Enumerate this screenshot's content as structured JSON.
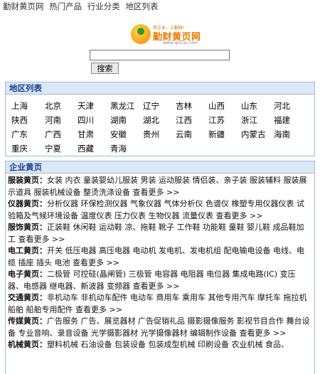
{
  "topnav": [
    "勤财黄页网",
    "热门产品",
    "行业分类",
    "地区列表"
  ],
  "logo": {
    "slogan": "我企业，上勤财!",
    "text": "勤财黄页网",
    "url": "www.qincai.com"
  },
  "search": {
    "button_label": "搜索",
    "value": ""
  },
  "region": {
    "title": "地区列表",
    "rows": [
      [
        "上海",
        "北京",
        "天津",
        "黑龙江",
        "辽宁",
        "吉林",
        "山西",
        "山东",
        "河北"
      ],
      [
        "陕西",
        "河南",
        "四川",
        "湖南",
        "湖北",
        "江西",
        "江苏",
        "浙江",
        "福建"
      ],
      [
        "广东",
        "广西",
        "甘肃",
        "安徽",
        "贵州",
        "云南",
        "新疆",
        "内蒙古",
        "海南"
      ],
      [
        "重庆",
        "宁夏",
        "西藏",
        "青海"
      ]
    ]
  },
  "business": {
    "title": "企业黄页",
    "items": [
      {
        "cat": "服装黄页：",
        "items": "女装 内衣 童装婴幼儿服装 男装 运动服装 情侣装、亲子装 服装辅料 服装展示道具 服装机械设备 整烫洗涤设备",
        "more": "查看更多",
        "arrow": ">>"
      },
      {
        "cat": "仪器黄页：",
        "items": "分析仪器 环保检测仪器 气象仪器 气体分析仪 色谱仪 橡塑专用仪器仪表 试验箱及气候环境设备 温度仪表 压力仪表 生物仪器 流量仪表",
        "more": "查看更多",
        "arrow": ">>"
      },
      {
        "cat": "服饰黄页：",
        "items": "正装鞋 休闲鞋 运动鞋 凉、拖鞋 靴子 工作鞋 功能鞋 童鞋 婴儿鞋 成品鞋加工",
        "more": "查看更多",
        "arrow": ">>"
      },
      {
        "cat": "电工黄页：",
        "items": "开关 低压电器 高压电器 电动机 发电机、发电机组 配电输电设备 电线、电缆 插座 插头 电池",
        "more": "查看更多",
        "arrow": ">>"
      },
      {
        "cat": "电子黄页：",
        "items": "二极管 可控硅(晶闸管) 三极管 电容器 电阻器 电位器 集成电路(IC) 变压器、电感器 继电器、新波器 变频器",
        "more": "查看更多",
        "arrow": ">>"
      },
      {
        "cat": "交通黄页：",
        "items": "非机动车 非机动车配件 电动车 商用车 乘用车 其他专用汽车 摩托车 拖拉机 船舶 船舶专用配件",
        "more": "查看更多",
        "arrow": ">>"
      },
      {
        "cat": "传媒黄页：",
        "items": "广告服务 广告、展览器材 广告促销礼品 摄影摄像服务 影视节目合作 舞台设备 专业音响、录音设备 光学摄影器材 光学摄像器材 编辑制作设备",
        "more": "查看更多",
        "arrow": ">>"
      },
      {
        "cat": "机械黄页：",
        "items": "塑料机械 石油设备 包装设备 包装成型机械 印刷设备 农业机械 食品、",
        "more": "",
        "arrow": ""
      }
    ]
  }
}
